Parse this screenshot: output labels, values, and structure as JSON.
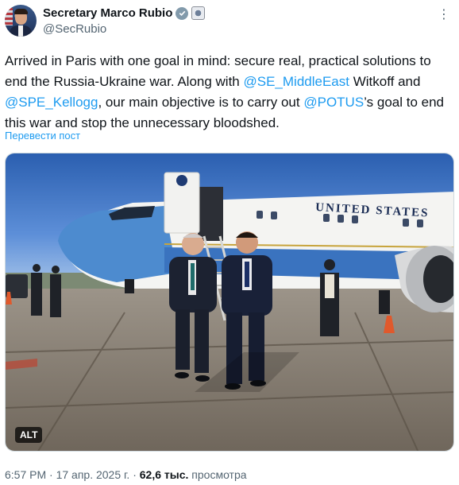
{
  "author": {
    "display_name": "Secretary Marco Rubio",
    "handle": "@SecRubio",
    "avatar_icon": "avatar-photo",
    "verified_icon": "verified-badge-icon",
    "affiliation_icon": "government-seal-icon"
  },
  "more_icon": "more-options-icon",
  "tweet": {
    "segments": [
      {
        "text": "Arrived in Paris with one goal in mind: secure real, practical solutions to end the Russia-Ukraine war. Along with ",
        "type": "text"
      },
      {
        "text": "@SE_MiddleEast",
        "type": "mention"
      },
      {
        "text": " Witkoff and ",
        "type": "text"
      },
      {
        "text": "@SPE_Kellogg",
        "type": "mention"
      },
      {
        "text": ", our main objective is to carry out ",
        "type": "text"
      },
      {
        "text": "@POTUS",
        "type": "mention"
      },
      {
        "text": "’s goal to end this war and stop the unnecessary bloodshed.",
        "type": "text"
      }
    ],
    "translate_label": "Перевести пост"
  },
  "media": {
    "alt_label": "ALT",
    "aircraft_text": "UNITED STATES"
  },
  "meta": {
    "time": "6:57 PM",
    "separator1": " · ",
    "date": "17 апр. 2025 г.",
    "separator2": " · ",
    "views_count": "62,6 тыс.",
    "views_label": " просмотра"
  },
  "colors": {
    "link": "#1d9bf0",
    "secondary_text": "#536471",
    "primary_text": "#0f1419"
  }
}
